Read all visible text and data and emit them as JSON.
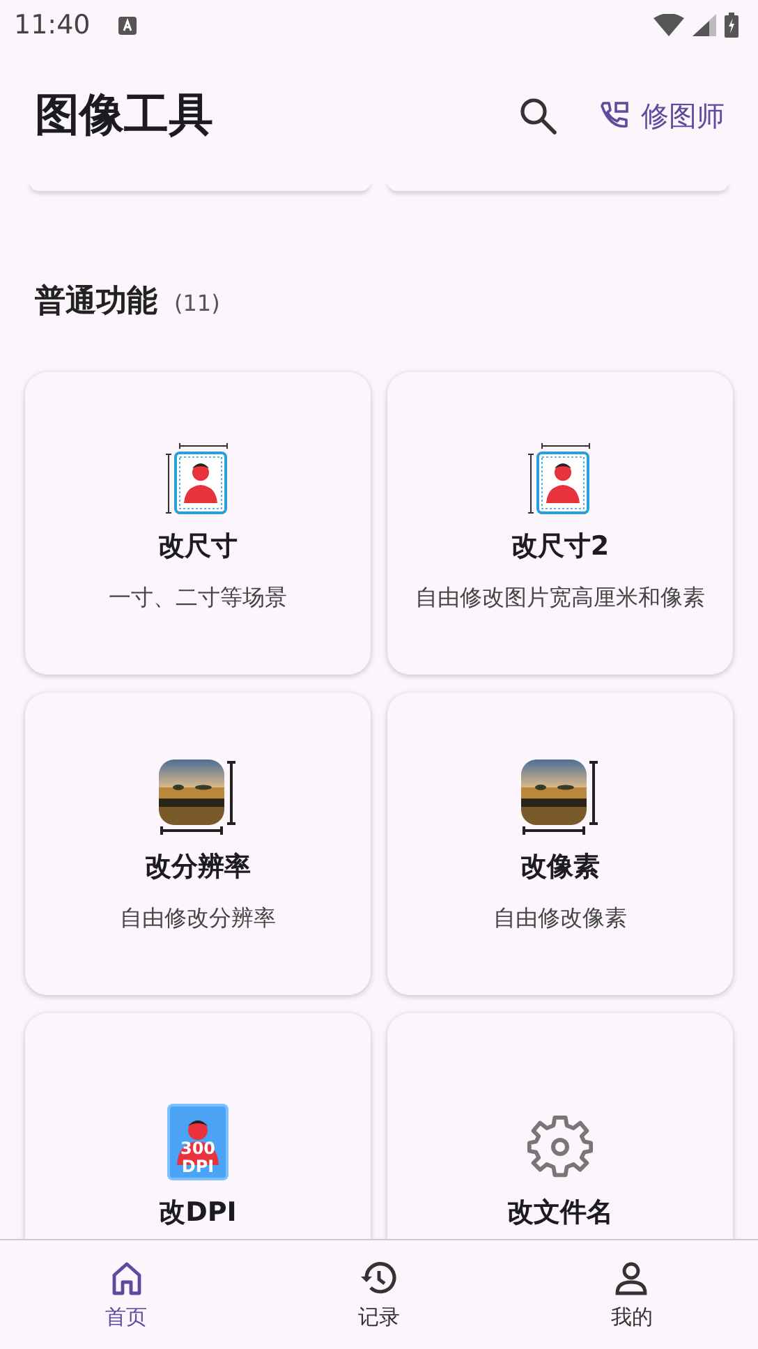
{
  "status_bar": {
    "time": "11:40"
  },
  "app_bar": {
    "title": "图像工具",
    "action_label": "修图师"
  },
  "section": {
    "title": "普通功能",
    "count": "(11)"
  },
  "cards": [
    {
      "kind": "id-photo",
      "title": "改尺寸",
      "subtitle": "一寸、二寸等场景"
    },
    {
      "kind": "id-photo",
      "title": "改尺寸2",
      "subtitle": "自由修改图片宽高厘米和像素"
    },
    {
      "kind": "landscape",
      "title": "改分辨率",
      "subtitle": "自由修改分辨率"
    },
    {
      "kind": "landscape",
      "title": "改像素",
      "subtitle": "自由修改像素"
    },
    {
      "kind": "dpi",
      "title": "改DPI",
      "icon_text": [
        "300",
        "DPI"
      ]
    },
    {
      "kind": "gear",
      "title": "改文件名"
    }
  ],
  "nav": [
    {
      "kind": "home",
      "label": "首页",
      "selected": true
    },
    {
      "kind": "history",
      "label": "记录",
      "selected": false
    },
    {
      "kind": "person",
      "label": "我的",
      "selected": false
    }
  ]
}
